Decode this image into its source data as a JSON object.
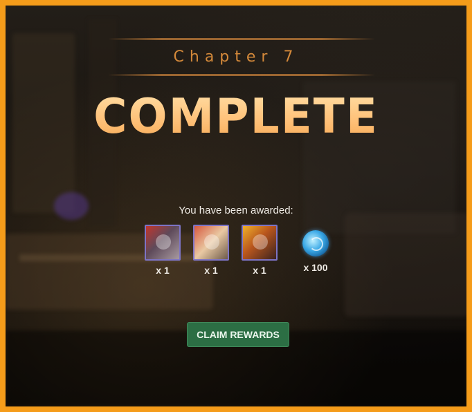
{
  "header": {
    "chapter": "Chapter 7",
    "status": "COMPLETE"
  },
  "rewards": {
    "heading": "You have been awarded:",
    "items": [
      {
        "icon": "hero-portrait-red-beast",
        "quantity": "x 1"
      },
      {
        "icon": "hero-portrait-white-hair",
        "quantity": "x 1"
      },
      {
        "icon": "hero-portrait-fire",
        "quantity": "x 1"
      },
      {
        "icon": "blue-orb-currency",
        "quantity": "x 100"
      }
    ]
  },
  "actions": {
    "claim_label": "CLAIM REWARDS"
  },
  "colors": {
    "frame": "#f59c1a",
    "accent": "#d4893a",
    "title": "#ffc37a",
    "button": "#2c6e44"
  }
}
